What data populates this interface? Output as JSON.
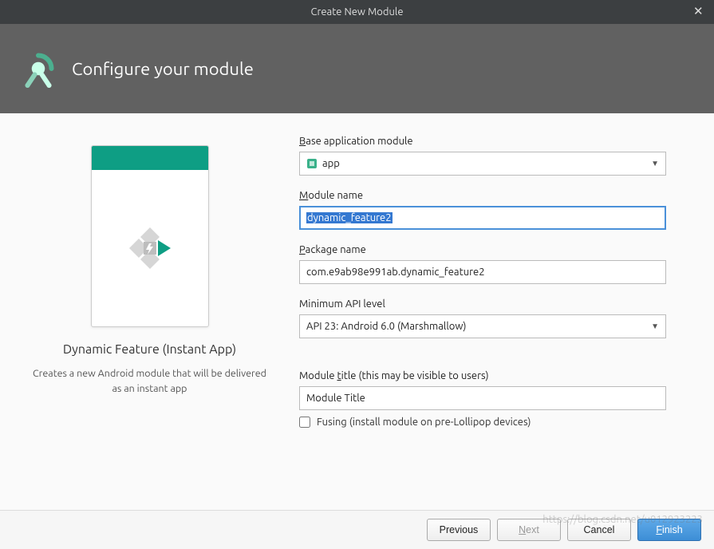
{
  "window": {
    "title": "Create New Module"
  },
  "banner": {
    "title": "Configure your module"
  },
  "left": {
    "card_title": "Dynamic Feature (Instant App)",
    "card_desc": "Creates a new Android module that will be delivered as an instant app"
  },
  "form": {
    "base_module": {
      "label": "Base application module",
      "value": "app"
    },
    "module_name": {
      "label": "Module name",
      "value": "dynamic_feature2"
    },
    "package_name": {
      "label": "Package name",
      "value": "com.e9ab98e991ab.dynamic_feature2"
    },
    "min_api": {
      "label": "Minimum API level",
      "value": "API 23: Android 6.0 (Marshmallow)"
    },
    "module_title": {
      "label": "Module title (this may be visible to users)",
      "value": "Module Title"
    },
    "fusing": {
      "label": "Fusing (install module on pre-Lollipop devices)",
      "checked": false
    }
  },
  "buttons": {
    "previous": "Previous",
    "next": "Next",
    "cancel": "Cancel",
    "finish": "Finish"
  },
  "watermark": "https://blog.csdn.net/u012923223"
}
